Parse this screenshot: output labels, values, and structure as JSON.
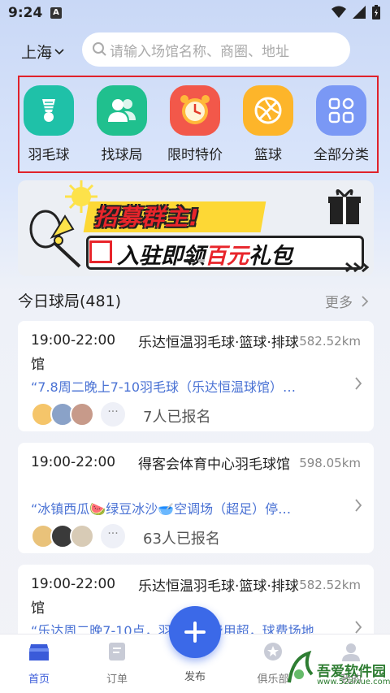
{
  "status_bar": {
    "time": "9:24",
    "notif": "A"
  },
  "header": {
    "city": "上海",
    "search_placeholder": "请输入场馆名称、商圈、地址"
  },
  "categories": [
    {
      "label": "羽毛球",
      "icon": "badminton-icon",
      "color": "#1fc1a8"
    },
    {
      "label": "找球局",
      "icon": "people-icon",
      "color": "#20c08e"
    },
    {
      "label": "限时特价",
      "icon": "alarm-clock-icon",
      "color": "#f2584a"
    },
    {
      "label": "篮球",
      "icon": "basketball-icon",
      "color": "#fdb52a"
    },
    {
      "label": "全部分类",
      "icon": "grid-icon",
      "color": "#7a98f5"
    }
  ],
  "banner": {
    "line1": "招募群主!",
    "line2_a": "入驻即领",
    "line2_b": "百元",
    "line2_c": "礼包"
  },
  "section": {
    "title": "今日球局(481)",
    "more": "更多"
  },
  "games": [
    {
      "time": "19:00-22:00",
      "venue": "乐达恒温羽毛球·篮球·排球馆",
      "distance": "582.52km",
      "desc": "“7.8周二晚上7-10羽毛球（乐达恒温球馆）…",
      "count": "7人已报名"
    },
    {
      "time": "19:00-22:00",
      "venue": "得客会体育中心羽毛球馆",
      "distance": "598.05km",
      "desc": "“冰镇西瓜🍉绿豆冰沙🥣空调场（超足）停…",
      "count": "63人已报名"
    },
    {
      "time": "19:00-22:00",
      "venue": "乐达恒温羽毛球·篮球·排球馆",
      "distance": "582.52km",
      "desc": "“乐达周二晚7-10点，羽毛球，费用超，球费场地…",
      "count": ""
    }
  ],
  "avatar_more": "···",
  "tabs": [
    {
      "label": "首页",
      "icon": "home-icon",
      "active": true
    },
    {
      "label": "订单",
      "icon": "order-icon",
      "active": false
    },
    {
      "label": "发布",
      "icon": "plus-icon",
      "active": false
    },
    {
      "label": "俱乐部",
      "icon": "club-icon",
      "active": false
    },
    {
      "label": "我的",
      "icon": "profile-icon",
      "active": false
    }
  ],
  "watermark": {
    "text": "吾爱软件园",
    "url": "www.52zixue.com"
  },
  "colors": {
    "accent": "#3b69e8",
    "link": "#4a72d4",
    "highlight_border": "#e0222b"
  }
}
